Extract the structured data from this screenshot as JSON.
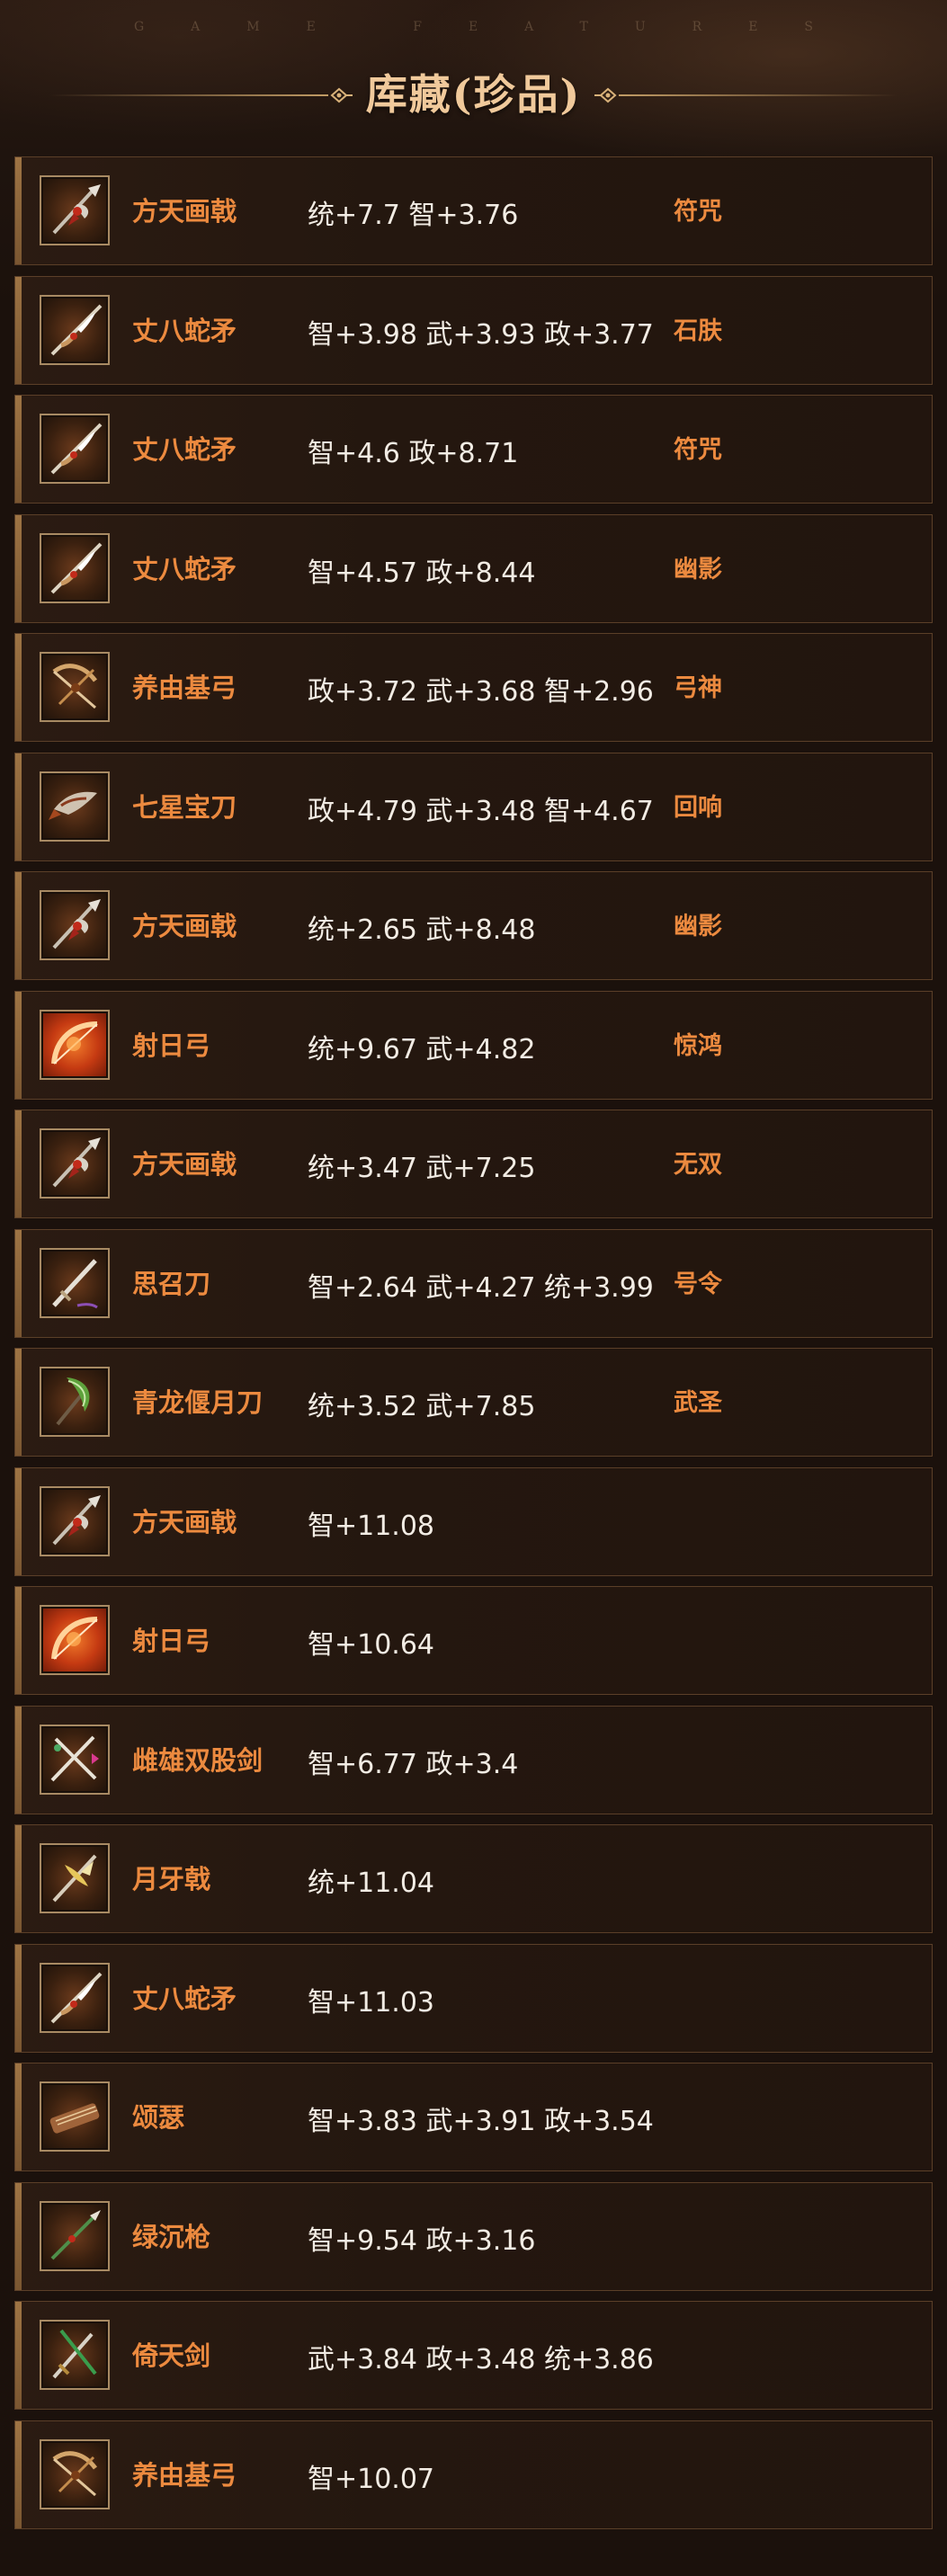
{
  "header": {
    "subtitle": "GAME FEATURES",
    "title": "库藏(珍品)"
  },
  "colors": {
    "accent_orange": "#ec8a3f",
    "title_gold": "#f0c99b",
    "row_border": "#5b3f28",
    "background": "#1b110c"
  },
  "items": [
    {
      "name": "方天画戟",
      "stats": "统+7.7 智+3.76",
      "skill": "符咒",
      "icon": "halberd-icon"
    },
    {
      "name": "丈八蛇矛",
      "stats": "智+3.98 武+3.93 政+3.77",
      "skill": "石肤",
      "icon": "snake-spear-icon"
    },
    {
      "name": "丈八蛇矛",
      "stats": "智+4.6 政+8.71",
      "skill": "符咒",
      "icon": "snake-spear-icon"
    },
    {
      "name": "丈八蛇矛",
      "stats": "智+4.57 政+8.44",
      "skill": "幽影",
      "icon": "snake-spear-icon"
    },
    {
      "name": "养由基弓",
      "stats": "政+3.72 武+3.68 智+2.96",
      "skill": "弓神",
      "icon": "crossbow-icon"
    },
    {
      "name": "七星宝刀",
      "stats": "政+4.79 武+3.48 智+4.67",
      "skill": "回响",
      "icon": "dagger-icon"
    },
    {
      "name": "方天画戟",
      "stats": "统+2.65 武+8.48",
      "skill": "幽影",
      "icon": "halberd-icon"
    },
    {
      "name": "射日弓",
      "stats": "统+9.67 武+4.82",
      "skill": "惊鸿",
      "icon": "sun-bow-icon"
    },
    {
      "name": "方天画戟",
      "stats": "统+3.47 武+7.25",
      "skill": "无双",
      "icon": "halberd-icon"
    },
    {
      "name": "思召刀",
      "stats": "智+2.64 武+4.27 统+3.99",
      "skill": "号令",
      "icon": "sword-icon"
    },
    {
      "name": "青龙偃月刀",
      "stats": "统+3.52 武+7.85",
      "skill": "武圣",
      "icon": "glaive-icon"
    },
    {
      "name": "方天画戟",
      "stats": "智+11.08",
      "skill": "",
      "icon": "halberd-icon"
    },
    {
      "name": "射日弓",
      "stats": "智+10.64",
      "skill": "",
      "icon": "sun-bow-icon"
    },
    {
      "name": "雌雄双股剑",
      "stats": "智+6.77 政+3.4",
      "skill": "",
      "icon": "twin-swords-icon"
    },
    {
      "name": "月牙戟",
      "stats": "统+11.04",
      "skill": "",
      "icon": "crescent-halberd-icon"
    },
    {
      "name": "丈八蛇矛",
      "stats": "智+11.03",
      "skill": "",
      "icon": "snake-spear-icon"
    },
    {
      "name": "颂瑟",
      "stats": "智+3.83 武+3.91 政+3.54",
      "skill": "",
      "icon": "zither-icon"
    },
    {
      "name": "绿沉枪",
      "stats": "智+9.54 政+3.16",
      "skill": "",
      "icon": "green-spear-icon"
    },
    {
      "name": "倚天剑",
      "stats": "武+3.84 政+3.48 统+3.86",
      "skill": "",
      "icon": "heaven-sword-icon"
    },
    {
      "name": "养由基弓",
      "stats": "智+10.07",
      "skill": "",
      "icon": "crossbow-icon"
    }
  ]
}
